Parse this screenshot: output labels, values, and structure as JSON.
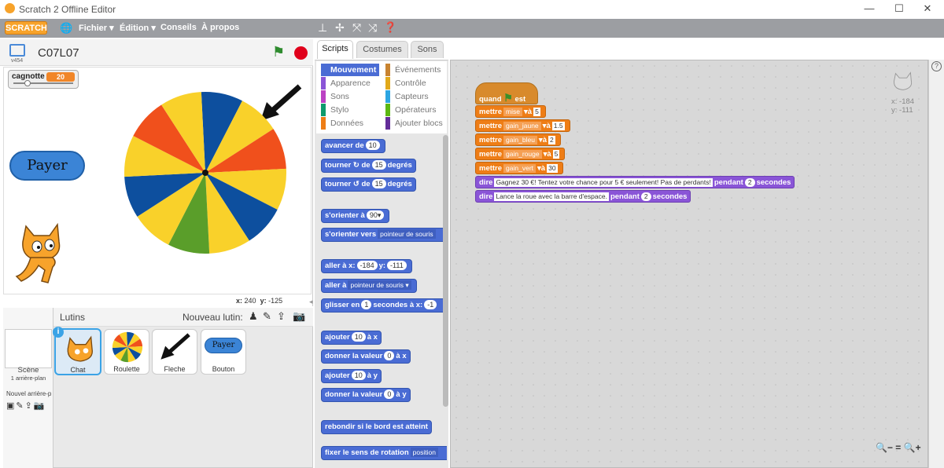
{
  "window": {
    "title": "Scratch 2 Offline Editor",
    "minimize": "—",
    "maximize": "☐",
    "close": "✕"
  },
  "menu": {
    "logo": "SCRATCH",
    "file": "Fichier ▾",
    "edit": "Édition ▾",
    "tips": "Conseils",
    "about": "À propos"
  },
  "stage": {
    "project_name": "C07L07",
    "version": "v454",
    "variable": {
      "name": "cagnotte",
      "value": "20"
    },
    "pay_button": "Payer",
    "mouse_x_label": "x:",
    "mouse_x": "240",
    "mouse_y_label": "y:",
    "mouse_y": "-125"
  },
  "sprites": {
    "header": "Lutins",
    "new_sprite": "Nouveau lutin:",
    "scene_label": "Scène",
    "scene_sub": "1 arrière-plan",
    "new_backdrop": "Nouvel arrière-p",
    "items": [
      {
        "name": "Chat",
        "selected": true
      },
      {
        "name": "Roulette"
      },
      {
        "name": "Fleche"
      },
      {
        "name": "Bouton",
        "thumb_text": "Payer"
      }
    ]
  },
  "tabs": [
    "Scripts",
    "Costumes",
    "Sons"
  ],
  "categories": {
    "left": [
      {
        "label": "Mouvement",
        "color": "#4a6cd4",
        "selected": true
      },
      {
        "label": "Apparence",
        "color": "#8a55d7"
      },
      {
        "label": "Sons",
        "color": "#bb42c3"
      },
      {
        "label": "Stylo",
        "color": "#0e9a6c"
      },
      {
        "label": "Données",
        "color": "#ee7d16"
      }
    ],
    "right": [
      {
        "label": "Événements",
        "color": "#c88330"
      },
      {
        "label": "Contrôle",
        "color": "#e1a91a"
      },
      {
        "label": "Capteurs",
        "color": "#2ca5e2"
      },
      {
        "label": "Opérateurs",
        "color": "#5cb712"
      },
      {
        "label": "Ajouter blocs",
        "color": "#632d99"
      }
    ]
  },
  "palette": {
    "move": "avancer de",
    "move_n": "10",
    "turn_r": "tourner",
    "turn_r_n": "15",
    "degrees": "degrés",
    "turn_l": "tourner",
    "turn_l_n": "15",
    "de": "de",
    "point_dir": "s'orienter à",
    "point_dir_v": "90▾",
    "point_to": "s'orienter vers",
    "point_to_v": "pointeur de souris",
    "goto_xy": "aller à x:",
    "goto_x": "-184",
    "y": "y:",
    "goto_y": "-111",
    "goto": "aller à",
    "goto_v": "pointeur de souris ▾",
    "glide": "glisser en",
    "glide_n": "1",
    "glide_s": "secondes à x:",
    "glide_x": "-1",
    "change_x": "ajouter",
    "change_x_n": "10",
    "a_x": "à x",
    "set_x": "donner la valeur",
    "set_x_n": "0",
    "a_x2": "à x",
    "change_y": "ajouter",
    "change_y_n": "10",
    "a_y": "à y",
    "set_y": "donner la valeur",
    "set_y_n": "0",
    "a_y2": "à y",
    "bounce": "rebondir si le bord est atteint",
    "rot": "fixer le sens de rotation",
    "rot_v": "position"
  },
  "script": {
    "hat": "quand",
    "hat_suffix": "est cliqué",
    "set_label": "mettre",
    "to": "à",
    "sets": [
      {
        "var": "mise",
        "value": "5"
      },
      {
        "var": "gain_jaune",
        "value": "1.5"
      },
      {
        "var": "gain_bleu",
        "value": "2"
      },
      {
        "var": "gain_rouge",
        "value": "5"
      },
      {
        "var": "gain_vert",
        "value": "30"
      }
    ],
    "say_label": "dire",
    "say1": "Gagnez 30 €! Tentez votre chance pour 5 € seulement! Pas de perdants!",
    "say2": "Lance la roue avec la barre d'espace.",
    "during": "pendant",
    "secs": "2",
    "seconds": "secondes"
  },
  "sprite_info": {
    "x_label": "x:",
    "x": "-184",
    "y_label": "y:",
    "y": "-111"
  },
  "zoom": {
    "out": "🔍−",
    "reset": "=",
    "in": "🔍+"
  },
  "colors": {
    "wheel_yellow": "#f9d12a",
    "wheel_blue": "#0d4f9e",
    "wheel_red": "#f0501c",
    "wheel_green": "#5a9e2a"
  }
}
